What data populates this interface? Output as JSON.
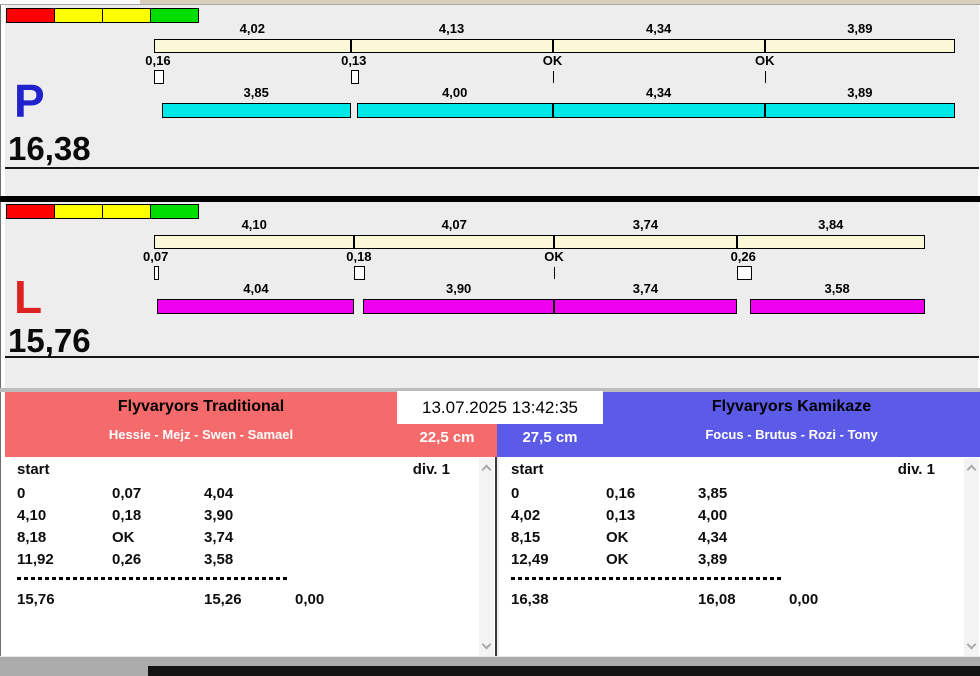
{
  "datetime": "13.07.2025 13:42:35",
  "traffic_light_colors": [
    "#FF0000",
    "#FFFF00",
    "#FFFF00",
    "#00DE00"
  ],
  "track_color": "#FBF8D8",
  "lanes": [
    {
      "letter": "P",
      "letter_color": "#2222CC",
      "total": "16,38",
      "total_val": 16.38,
      "bar_color": "#00E8E8",
      "starts": [
        0,
        4.02,
        8.15,
        12.49
      ],
      "segments": [
        {
          "gross": "4,02",
          "loss": "0,16",
          "loss_val": 0.16,
          "net": "3,85"
        },
        {
          "gross": "4,13",
          "loss": "0,13",
          "loss_val": 0.13,
          "net": "4,00"
        },
        {
          "gross": "4,34",
          "loss": "OK",
          "loss_val": 0,
          "net": "4,34"
        },
        {
          "gross": "3,89",
          "loss": "OK",
          "loss_val": 0,
          "net": "3,89"
        }
      ]
    },
    {
      "letter": "L",
      "letter_color": "#DD2222",
      "total": "15,76",
      "total_val": 15.76,
      "bar_color": "#EE00EE",
      "starts": [
        0,
        4.1,
        8.18,
        11.92
      ],
      "segments": [
        {
          "gross": "4,10",
          "loss": "0,07",
          "loss_val": 0.07,
          "net": "4,04"
        },
        {
          "gross": "4,07",
          "loss": "0,18",
          "loss_val": 0.18,
          "net": "3,90"
        },
        {
          "gross": "3,74",
          "loss": "OK",
          "loss_val": 0,
          "net": "3,74"
        },
        {
          "gross": "3,84",
          "loss": "0,26",
          "loss_val": 0.26,
          "net": "3,58"
        }
      ]
    }
  ],
  "teams": [
    {
      "name": "Flyvaryors Traditional",
      "members": "Hessie - Mejz - Swen - Samael",
      "jump_height": "22,5 cm",
      "color": "#F56A6A",
      "table": {
        "header_left": "start",
        "header_right": "div.  1",
        "rows": [
          [
            "0",
            "0,07",
            "4,04"
          ],
          [
            "4,10",
            "0,18",
            "3,90"
          ],
          [
            "8,18",
            "OK",
            "3,74"
          ],
          [
            "11,92",
            "0,26",
            "3,58"
          ]
        ],
        "totals": [
          "15,76",
          "15,26",
          "0,00"
        ]
      }
    },
    {
      "name": "Flyvaryors Kamikaze",
      "members": "Focus - Brutus - Rozi - Tony",
      "jump_height": "27,5 cm",
      "color": "#5B5BE8",
      "table": {
        "header_left": "start",
        "header_right": "div.  1",
        "rows": [
          [
            "0",
            "0,16",
            "3,85"
          ],
          [
            "4,02",
            "0,13",
            "4,00"
          ],
          [
            "8,15",
            "OK",
            "4,34"
          ],
          [
            "12,49",
            "OK",
            "3,89"
          ]
        ],
        "totals": [
          "16,38",
          "16,08",
          "0,00"
        ]
      }
    }
  ]
}
